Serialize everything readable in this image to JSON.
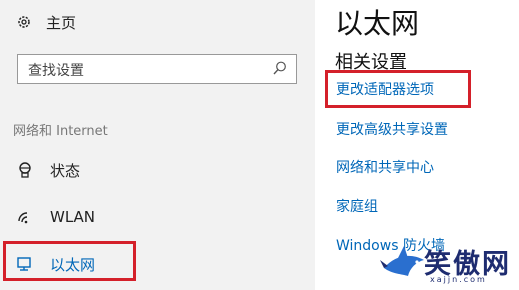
{
  "sidebar": {
    "home_label": "主页",
    "search_placeholder": "查找设置",
    "section_label": "网络和 Internet",
    "items": [
      {
        "label": "状态",
        "icon": "status-icon"
      },
      {
        "label": "WLAN",
        "icon": "wifi-icon"
      },
      {
        "label": "以太网",
        "icon": "ethernet-icon",
        "selected": true
      }
    ]
  },
  "main": {
    "title": "以太网",
    "related_title": "相关设置",
    "links": [
      "更改适配器选项",
      "更改高级共享设置",
      "网络和共享中心",
      "家庭组",
      "Windows 防火墙"
    ]
  },
  "watermark": {
    "text": "笑傲网",
    "url": "xajjn.com"
  },
  "colors": {
    "accent": "#0067b8",
    "highlight_box": "#d4202a",
    "sidebar_bg": "#f2f2f2"
  }
}
